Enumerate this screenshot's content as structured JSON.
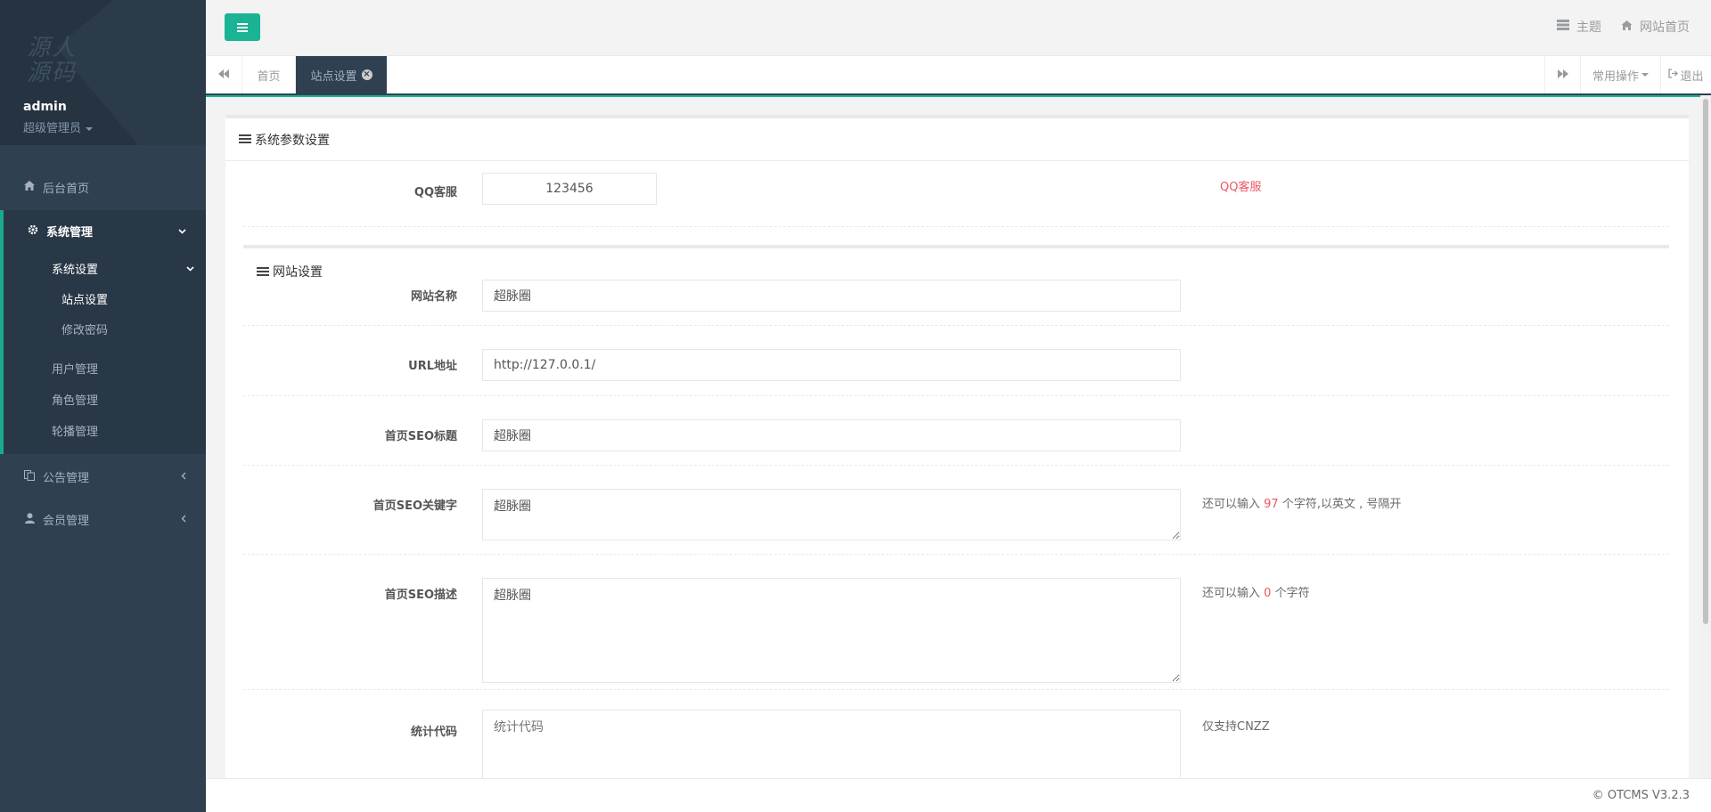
{
  "sidebar": {
    "logo_text": "源人源码",
    "user": {
      "name": "admin",
      "role": "超级管理员"
    },
    "menu": {
      "home": "后台首页",
      "system": "系统管理",
      "system_settings": "系统设置",
      "site_settings": "站点设置",
      "change_password": "修改密码",
      "user_mgmt": "用户管理",
      "role_mgmt": "角色管理",
      "carousel_mgmt": "轮播管理",
      "notice_mgmt": "公告管理",
      "member_mgmt": "会员管理"
    }
  },
  "topbar": {
    "theme": "主题",
    "site_home": "网站首页"
  },
  "tabs": {
    "home": "首页",
    "active": "站点设置",
    "common_ops": "常用操作",
    "logout": "退出"
  },
  "panel": {
    "title": "系统参数设置",
    "qq": {
      "label": "QQ客服",
      "value": "123456",
      "hint": "QQ客服"
    },
    "website_section": "网站设置",
    "site_name": {
      "label": "网站名称",
      "value": "超脉圈"
    },
    "url": {
      "label": "URL地址",
      "value": "http://127.0.0.1/"
    },
    "seo_title": {
      "label": "首页SEO标题",
      "value": "超脉圈"
    },
    "seo_keywords": {
      "label": "首页SEO关键字",
      "value": "超脉圈",
      "hint_prefix": "还可以输入",
      "hint_count": "97",
      "hint_suffix": "个字符,以英文 , 号隔开"
    },
    "seo_desc": {
      "label": "首页SEO描述",
      "value": "超脉圈",
      "hint_prefix": "还可以输入",
      "hint_count": "0",
      "hint_suffix": "个字符"
    },
    "stats_code": {
      "label": "统计代码",
      "placeholder": "统计代码",
      "hint": "仅支持CNZZ"
    }
  },
  "footer": {
    "copyright": "© OTCMS V3.2.3"
  },
  "colors": {
    "accent": "#1ab394",
    "sidebar": "#2f4050",
    "hint_red": "#ed5565"
  }
}
